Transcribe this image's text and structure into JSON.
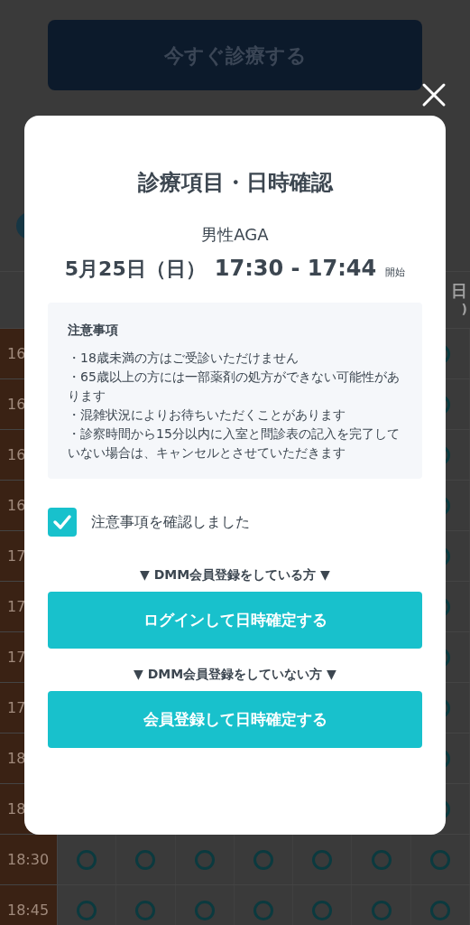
{
  "background": {
    "now_button": "今すぐ診療する",
    "header_day": "日",
    "header_sub": ")",
    "times": [
      "16",
      "16",
      "16",
      "16",
      "17",
      "17",
      "17",
      "17",
      "18",
      "18",
      "18:30",
      "18:45"
    ]
  },
  "modal": {
    "title": "診療項目・日時確認",
    "menu": "男性AGA",
    "date": "5月25日（日）",
    "time": "17:30 - 17:44",
    "time_suffix": "開始",
    "notice": {
      "heading": "注意事項",
      "items": [
        "・18歳未満の方はご受診いただけません",
        "・65歳以上の方には一部薬剤の処方ができない可能性があります",
        "・混雑状況によりお待ちいただくことがあります",
        "・診察時間から15分以内に入室と問診表の記入を完了していない場合は、キャンセルとさせていただきます"
      ]
    },
    "confirm": {
      "label": "注意事項を確認しました",
      "checked": true
    },
    "actions": [
      {
        "heading": "▼ DMM会員登録をしている方 ▼",
        "button": "ログインして日時確定する"
      },
      {
        "heading": "▼ DMM会員登録をしていない方 ▼",
        "button": "会員登録して日時確定する"
      }
    ]
  }
}
